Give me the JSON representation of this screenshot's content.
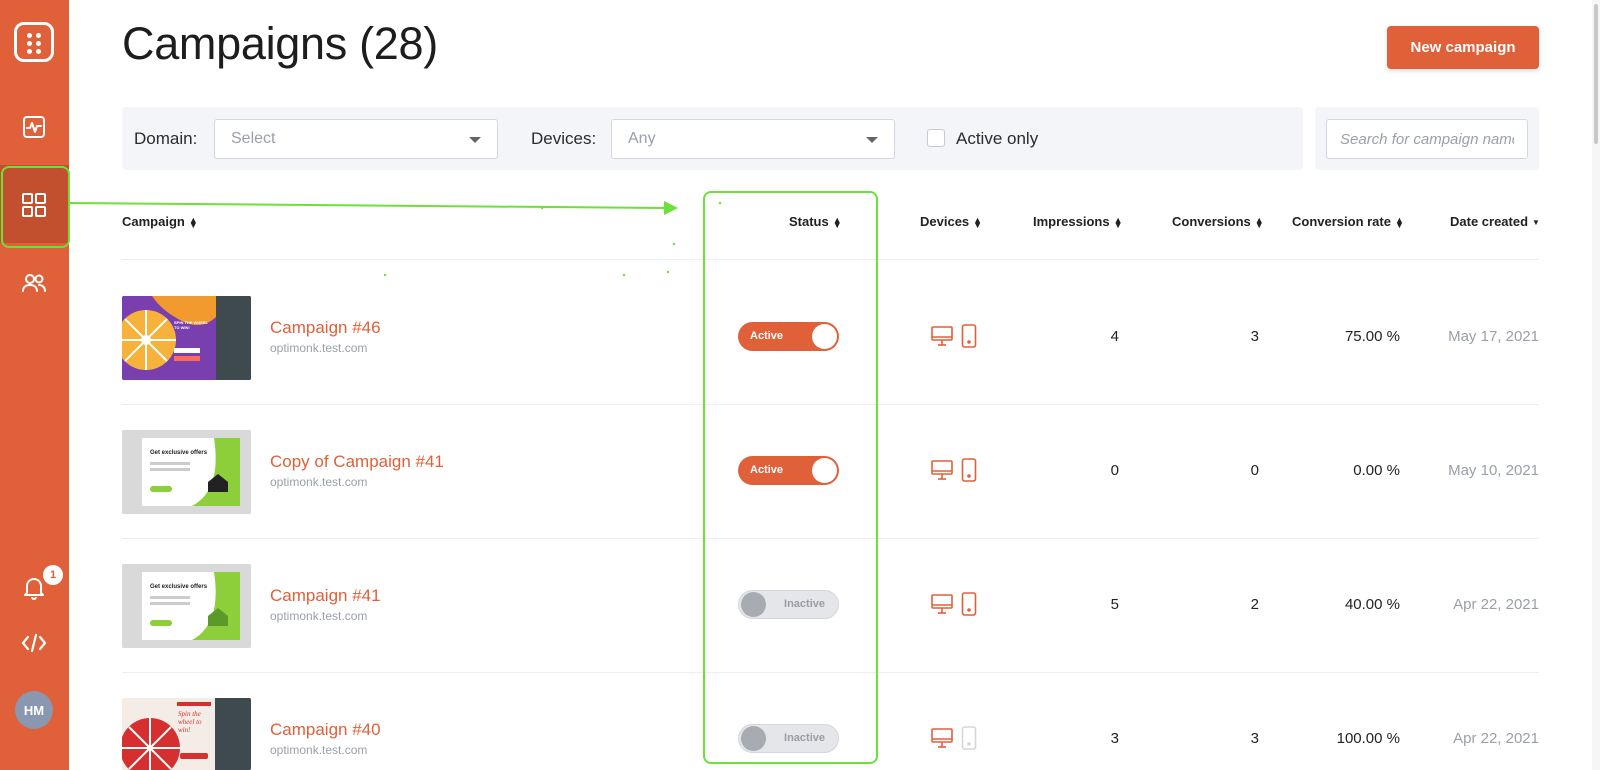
{
  "sidebar": {
    "badge_count": "1",
    "avatar_initials": "HM",
    "accent": "#e0603a"
  },
  "header": {
    "title": "Campaigns (28)",
    "new_button": "New campaign"
  },
  "filters": {
    "domain_label": "Domain:",
    "domain_value": "Select",
    "devices_label": "Devices:",
    "devices_value": "Any",
    "active_only_label": "Active only",
    "search_placeholder": "Search for campaign name"
  },
  "table": {
    "columns": {
      "campaign": "Campaign",
      "status": "Status",
      "devices": "Devices",
      "impressions": "Impressions",
      "conversions": "Conversions",
      "conversion_rate": "Conversion rate",
      "date_created": "Date created"
    },
    "rows": [
      {
        "name": "Campaign #46",
        "domain": "optimonk.test.com",
        "status": "Active",
        "impressions": "4",
        "conversions": "3",
        "rate": "75.00 %",
        "date": "May 17, 2021"
      },
      {
        "name": "Copy of Campaign #41",
        "domain": "optimonk.test.com",
        "status": "Active",
        "impressions": "0",
        "conversions": "0",
        "rate": "0.00 %",
        "date": "May 10, 2021"
      },
      {
        "name": "Campaign #41",
        "domain": "optimonk.test.com",
        "status": "Inactive",
        "impressions": "5",
        "conversions": "2",
        "rate": "40.00 %",
        "date": "Apr 22, 2021"
      },
      {
        "name": "Campaign #40",
        "domain": "optimonk.test.com",
        "status": "Inactive",
        "impressions": "3",
        "conversions": "3",
        "rate": "100.00 %",
        "date": "Apr 22, 2021"
      }
    ]
  },
  "thumbnails": {
    "spin_text": "SPIN THE WHEEL TO WIN!",
    "offer_text": "Get exclusive offers",
    "spin2_text": "Spin the wheel to win!"
  }
}
